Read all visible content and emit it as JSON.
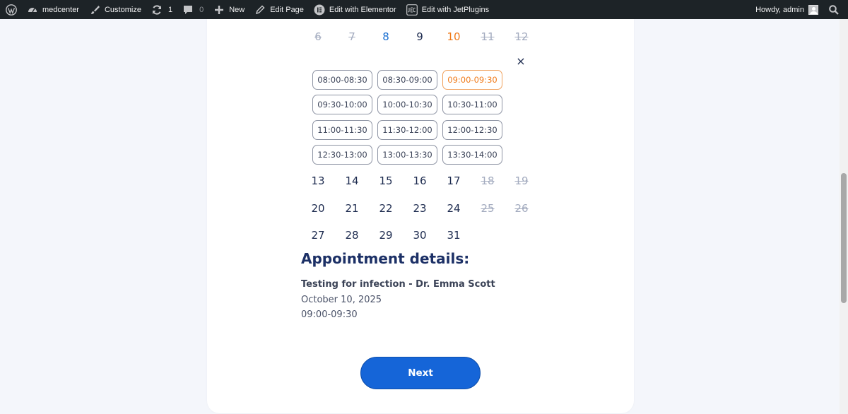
{
  "adminbar": {
    "site_name": "medcenter",
    "customize": "Customize",
    "updates_count": "1",
    "comments_count": "0",
    "new_label": "New",
    "edit_page": "Edit Page",
    "edit_elementor": "Edit with Elementor",
    "edit_jetplugins": "Edit with JetPlugins",
    "howdy": "Howdy, admin"
  },
  "calendar": {
    "week_top": [
      {
        "label": "6",
        "state": "disabled"
      },
      {
        "label": "7",
        "state": "disabled"
      },
      {
        "label": "8",
        "state": "available"
      },
      {
        "label": "9",
        "state": "normal"
      },
      {
        "label": "10",
        "state": "selected"
      },
      {
        "label": "11",
        "state": "disabled"
      },
      {
        "label": "12",
        "state": "disabled"
      }
    ],
    "week_2": [
      {
        "label": "13",
        "state": "normal"
      },
      {
        "label": "14",
        "state": "normal"
      },
      {
        "label": "15",
        "state": "normal"
      },
      {
        "label": "16",
        "state": "normal"
      },
      {
        "label": "17",
        "state": "normal"
      },
      {
        "label": "18",
        "state": "disabled"
      },
      {
        "label": "19",
        "state": "disabled"
      }
    ],
    "week_3": [
      {
        "label": "20",
        "state": "normal"
      },
      {
        "label": "21",
        "state": "normal"
      },
      {
        "label": "22",
        "state": "normal"
      },
      {
        "label": "23",
        "state": "normal"
      },
      {
        "label": "24",
        "state": "normal"
      },
      {
        "label": "25",
        "state": "disabled"
      },
      {
        "label": "26",
        "state": "disabled"
      }
    ],
    "week_4": [
      {
        "label": "27",
        "state": "normal"
      },
      {
        "label": "28",
        "state": "normal"
      },
      {
        "label": "29",
        "state": "normal"
      },
      {
        "label": "30",
        "state": "normal"
      },
      {
        "label": "31",
        "state": "normal"
      }
    ],
    "close_symbol": "×"
  },
  "slots": [
    {
      "label": "08:00-08:30",
      "selected": false
    },
    {
      "label": "08:30-09:00",
      "selected": false
    },
    {
      "label": "09:00-09:30",
      "selected": true
    },
    {
      "label": "09:30-10:00",
      "selected": false
    },
    {
      "label": "10:00-10:30",
      "selected": false
    },
    {
      "label": "10:30-11:00",
      "selected": false
    },
    {
      "label": "11:00-11:30",
      "selected": false
    },
    {
      "label": "11:30-12:00",
      "selected": false
    },
    {
      "label": "12:00-12:30",
      "selected": false
    },
    {
      "label": "12:30-13:00",
      "selected": false
    },
    {
      "label": "13:00-13:30",
      "selected": false
    },
    {
      "label": "13:30-14:00",
      "selected": false
    }
  ],
  "details": {
    "title": "Appointment details:",
    "service": "Testing for infection - Dr. Emma Scott",
    "date": "October 10, 2025",
    "time": "09:00-09:30"
  },
  "next_button": "Next",
  "colors": {
    "accent": "#1565d8",
    "selected": "#f07b1a",
    "available": "#1a6fd1",
    "disabled": "#a3abbf"
  }
}
